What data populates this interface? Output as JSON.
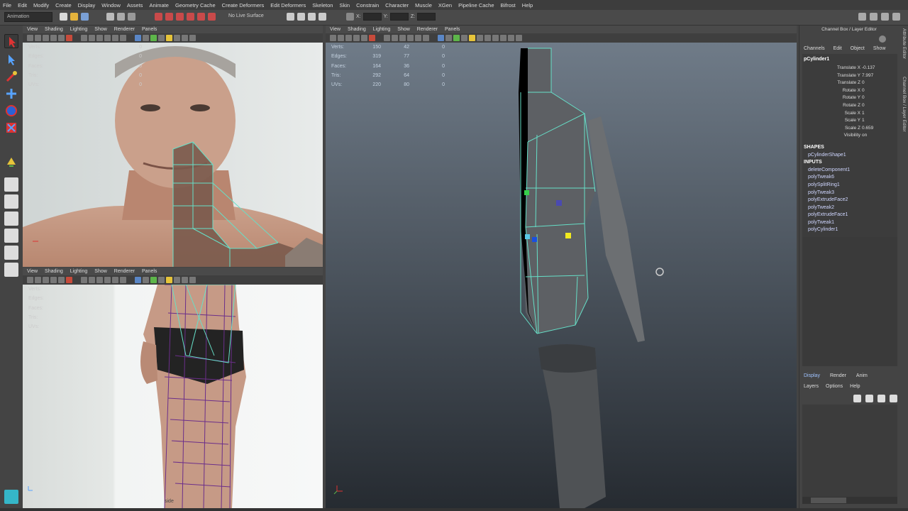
{
  "menubar": [
    "File",
    "Edit",
    "Modify",
    "Create",
    "Display",
    "Window",
    "Assets",
    "Animate",
    "Geometry Cache",
    "Create Deformers",
    "Edit Deformers",
    "Skeleton",
    "Skin",
    "Constrain",
    "Character",
    "Muscle",
    "XGen",
    "Pipeline Cache",
    "Bifrost",
    "Help"
  ],
  "statusline": {
    "mode": "Animation",
    "live_surface": "No Live Surface",
    "x_label": "X:",
    "y_label": "Y:",
    "z_label": "Z:"
  },
  "panel_menu": [
    "View",
    "Shading",
    "Lighting",
    "Show",
    "Renderer",
    "Panels"
  ],
  "hud_labels": [
    "Verts:",
    "Edges:",
    "Faces:",
    "Tris:",
    "UVs:"
  ],
  "persp_hud": {
    "verts": [
      "150",
      "42",
      "0"
    ],
    "edges": [
      "319",
      "77",
      "0"
    ],
    "faces": [
      "164",
      "36",
      "0"
    ],
    "tris": [
      "292",
      "64",
      "0"
    ],
    "uvs": [
      "220",
      "80",
      "0"
    ]
  },
  "front_hud": {
    "verts": [
      "",
      "",
      "0"
    ],
    "edges": [
      "",
      "",
      "0"
    ],
    "faces": [
      "",
      "",
      "0"
    ],
    "tris": [
      "",
      "",
      "0"
    ],
    "uvs": [
      "",
      "",
      "0"
    ]
  },
  "side_label": "side",
  "channelbox": {
    "title": "Channel Box / Layer Editor",
    "tabs": [
      "Channels",
      "Edit",
      "Object",
      "Show"
    ],
    "object": "pCylinder1",
    "attributes": [
      {
        "name": "Translate X",
        "value": "-0.137"
      },
      {
        "name": "Translate Y",
        "value": "7.997"
      },
      {
        "name": "Translate Z",
        "value": "0"
      },
      {
        "name": "Rotate X",
        "value": "0"
      },
      {
        "name": "Rotate Y",
        "value": "0"
      },
      {
        "name": "Rotate Z",
        "value": "0"
      },
      {
        "name": "Scale X",
        "value": "1"
      },
      {
        "name": "Scale Y",
        "value": "1"
      },
      {
        "name": "Scale Z",
        "value": "0.659"
      },
      {
        "name": "Visibility",
        "value": "on"
      }
    ],
    "shapes_head": "SHAPES",
    "shape": "pCylinderShape1",
    "inputs_head": "INPUTS",
    "inputs": [
      "deleteComponent1",
      "polyTweak6",
      "polySplitRing1",
      "polyTweak3",
      "polyExtrudeFace2",
      "polyTweak2",
      "polyExtrudeFace1",
      "polyTweak1",
      "polyCylinder1"
    ],
    "layer_tabs": [
      "Display",
      "Render",
      "Anim"
    ],
    "layer_menu": [
      "Layers",
      "Options",
      "Help"
    ],
    "side_tabs": [
      "Attribute Editor",
      "Channel Box / Layer Editor"
    ]
  },
  "colors": {
    "bg": "#444444",
    "viewport_top": "#6e7a86",
    "viewport_bottom": "#2b3036",
    "accent_green": "#5db64a",
    "wire": "#66e0c8",
    "selected_yellow": "#f2ea1f"
  }
}
